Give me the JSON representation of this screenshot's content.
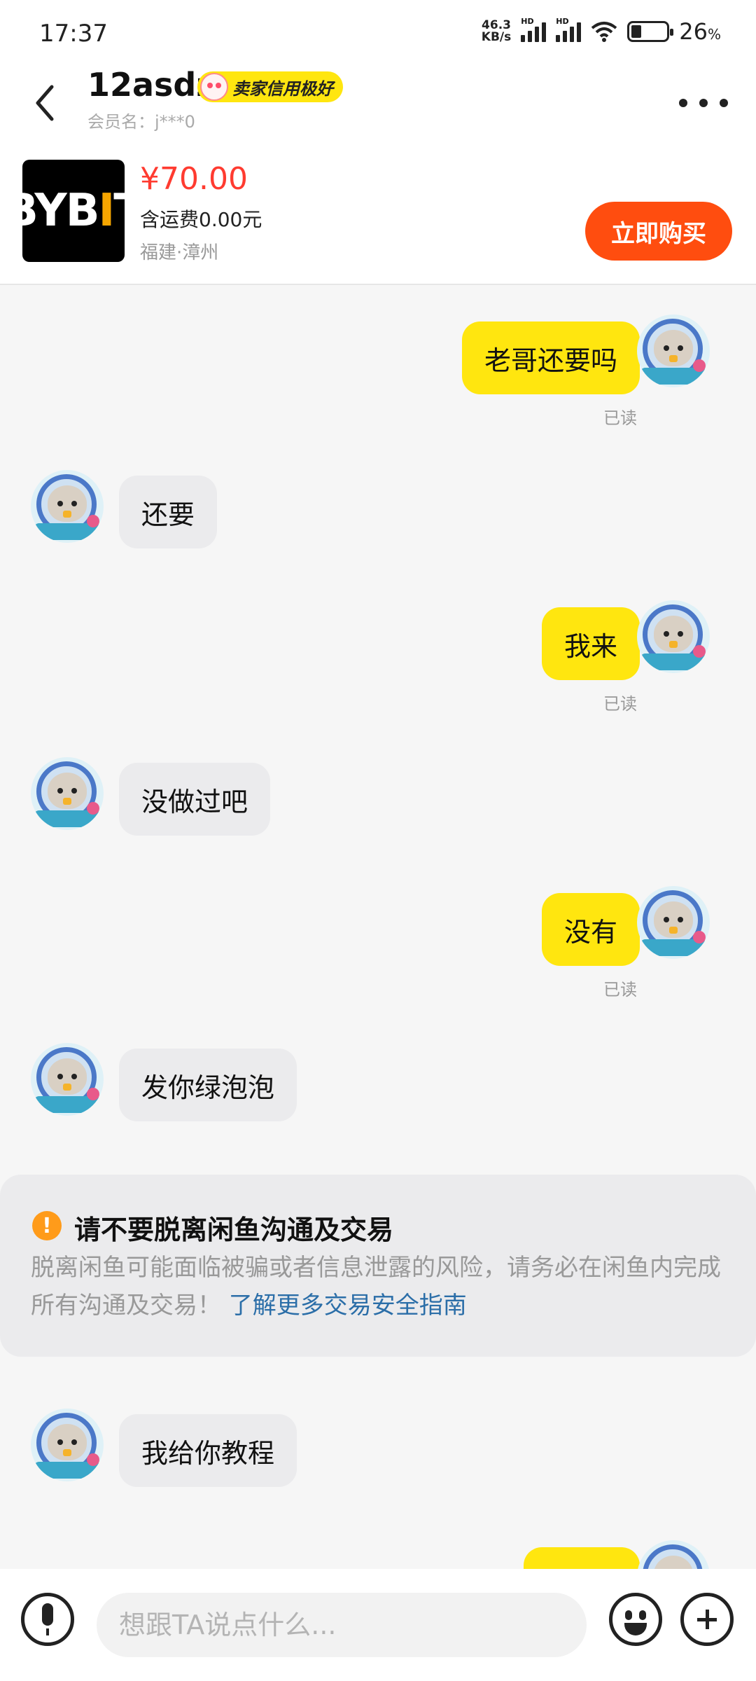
{
  "status_bar": {
    "time": "17:37",
    "net_speed_value": "46.3",
    "net_speed_unit": "KB/s",
    "hd_label": "HD",
    "battery_percent": "26",
    "battery_unit": "%"
  },
  "header": {
    "name": "12asdz",
    "badge": "卖家信用极好",
    "member_label": "会员名：j***0"
  },
  "product": {
    "image_text": "BYBIT",
    "price": "¥70.00",
    "shipping": "含运费0.00元",
    "location": "福建·漳州",
    "buy_button": "立即购买"
  },
  "messages": [
    {
      "side": "out",
      "text": "老哥还要吗",
      "status": "已读"
    },
    {
      "side": "in",
      "text": "还要"
    },
    {
      "side": "out",
      "text": "我来",
      "status": "已读"
    },
    {
      "side": "in",
      "text": "没做过吧"
    },
    {
      "side": "out",
      "text": "没有",
      "status": "已读"
    },
    {
      "side": "in",
      "text": "发你绿泡泡"
    },
    {
      "side": "in",
      "text": "我给你教程"
    }
  ],
  "warning": {
    "title": "请不要脱离闲鱼沟通及交易",
    "body": "脱离闲鱼可能面临被骗或者信息泄露的风险，请务必在闲鱼内完成所有沟通及交易！",
    "link": "了解更多交易安全指南"
  },
  "input": {
    "placeholder": "想跟TA说点什么..."
  },
  "icons": {
    "back": "back-arrow-icon",
    "more": "more-dots-icon",
    "mic": "microphone-icon",
    "emoji": "emoji-icon",
    "plus": "plus-icon"
  },
  "colors": {
    "accent_yellow": "#ffe60f",
    "price_red": "#ff3b30",
    "buy_orange": "#ff4d0f",
    "link_blue": "#2b6ea8"
  }
}
